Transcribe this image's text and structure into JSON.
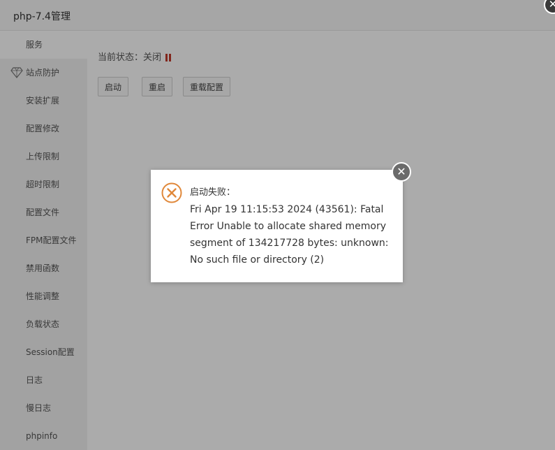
{
  "window": {
    "title": "php-7.4管理",
    "close_symbol": "✕"
  },
  "sidebar": {
    "items": [
      {
        "label": "服务",
        "active": true
      },
      {
        "label": "站点防护",
        "icon": "diamond-icon"
      },
      {
        "label": "安装扩展"
      },
      {
        "label": "配置修改"
      },
      {
        "label": "上传限制"
      },
      {
        "label": "超时限制"
      },
      {
        "label": "配置文件"
      },
      {
        "label": "FPM配置文件"
      },
      {
        "label": "禁用函数"
      },
      {
        "label": "性能调整"
      },
      {
        "label": "负载状态"
      },
      {
        "label": "Session配置"
      },
      {
        "label": "日志"
      },
      {
        "label": "慢日志"
      },
      {
        "label": "phpinfo"
      }
    ]
  },
  "main": {
    "status_label": "当前状态：",
    "status_value": "关闭",
    "status_icon": "pause-icon",
    "buttons": {
      "start": "启动",
      "restart": "重启",
      "reload": "重载配置"
    }
  },
  "dialog": {
    "icon": "error-circle-icon",
    "title": "启动失败：",
    "message": "Fri Apr 19 11:15:53 2024 (43561): Fatal Error Unable to allocate shared memory segment of 134217728 bytes: unknown: No such file or directory (2)",
    "close_symbol": "✕",
    "accent_color": "#e0883a"
  }
}
